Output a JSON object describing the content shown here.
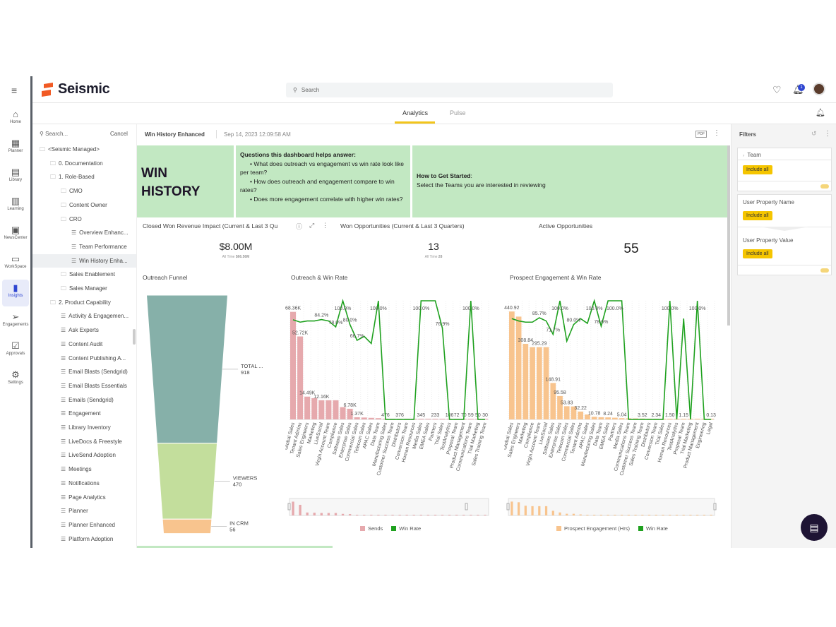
{
  "app": {
    "brand": "Seismic",
    "search_placeholder": "Search",
    "notification_count": "1"
  },
  "rail": [
    {
      "label": "Home",
      "icon": "⌂",
      "name": "home"
    },
    {
      "label": "Planner",
      "icon": "▦",
      "name": "planner"
    },
    {
      "label": "Library",
      "icon": "▤",
      "name": "library"
    },
    {
      "label": "Learning",
      "icon": "▥",
      "name": "learning"
    },
    {
      "label": "NewsCenter",
      "icon": "▣",
      "name": "newscenter"
    },
    {
      "label": "WorkSpace",
      "icon": "▭",
      "name": "workspace"
    },
    {
      "label": "Insights",
      "icon": "▮",
      "name": "insights",
      "active": true
    },
    {
      "label": "Engagements",
      "icon": "➢",
      "name": "engagements"
    },
    {
      "label": "Approvals",
      "icon": "☑",
      "name": "approvals"
    },
    {
      "label": "Settings",
      "icon": "⚙",
      "name": "settings"
    }
  ],
  "tabs": {
    "analytics": "Analytics",
    "pulse": "Pulse"
  },
  "tree": {
    "search_placeholder": "Search...",
    "cancel": "Cancel",
    "items": [
      {
        "label": "<Seismic Managed>",
        "level": 0,
        "type": "folder"
      },
      {
        "label": "0. Documentation",
        "level": 1,
        "type": "folder"
      },
      {
        "label": "1. Role-Based",
        "level": 1,
        "type": "folder"
      },
      {
        "label": "CMO",
        "level": 2,
        "type": "folder"
      },
      {
        "label": "Content Owner",
        "level": 2,
        "type": "folder"
      },
      {
        "label": "CRO",
        "level": 2,
        "type": "folder"
      },
      {
        "label": "Overview Enhanc...",
        "level": 3,
        "type": "report"
      },
      {
        "label": "Team Performance",
        "level": 3,
        "type": "report"
      },
      {
        "label": "Win History Enha...",
        "level": 3,
        "type": "report",
        "selected": true
      },
      {
        "label": "Sales Enablement",
        "level": 2,
        "type": "folder"
      },
      {
        "label": "Sales Manager",
        "level": 2,
        "type": "folder"
      },
      {
        "label": "2. Product Capability",
        "level": 1,
        "type": "folder"
      },
      {
        "label": "Activity & Engagemen...",
        "level": 2,
        "type": "report"
      },
      {
        "label": "Ask Experts",
        "level": 2,
        "type": "report"
      },
      {
        "label": "Content Audit",
        "level": 2,
        "type": "report"
      },
      {
        "label": "Content Publishing A...",
        "level": 2,
        "type": "report"
      },
      {
        "label": "Email Blasts (Sendgrid)",
        "level": 2,
        "type": "report"
      },
      {
        "label": "Email Blasts Essentials",
        "level": 2,
        "type": "report"
      },
      {
        "label": "Emails (Sendgrid)",
        "level": 2,
        "type": "report"
      },
      {
        "label": "Engagement",
        "level": 2,
        "type": "report"
      },
      {
        "label": "Library Inventory",
        "level": 2,
        "type": "report"
      },
      {
        "label": "LiveDocs & Freestyle",
        "level": 2,
        "type": "report"
      },
      {
        "label": "LiveSend Adoption",
        "level": 2,
        "type": "report"
      },
      {
        "label": "Meetings",
        "level": 2,
        "type": "report"
      },
      {
        "label": "Notifications",
        "level": 2,
        "type": "report"
      },
      {
        "label": "Page Analytics",
        "level": 2,
        "type": "report"
      },
      {
        "label": "Planner",
        "level": 2,
        "type": "report"
      },
      {
        "label": "Planner Enhanced",
        "level": 2,
        "type": "report"
      },
      {
        "label": "Platform Adoption",
        "level": 2,
        "type": "report"
      }
    ]
  },
  "report": {
    "title": "Win History Enhanced",
    "timestamp": "Sep 14, 2023 12:09:58 AM",
    "pdf_label": "PDF"
  },
  "banner": {
    "title_line1": "WIN",
    "title_line2": "HISTORY",
    "questions_heading": "Questions this dashboard helps answer:",
    "questions": [
      "What does outreach vs engagement vs win rate look like per team?",
      "How does outreach and engagement compare to win rates?",
      "Does more engagement correlate with higher win rates?"
    ],
    "start_heading": "How to Get Started",
    "start_text": "Select the Teams you are interested in reviewing"
  },
  "kpis": [
    {
      "title": "Closed Won Revenue Impact (Current & Last 3 Qu",
      "value": "$8.00M",
      "sub_label": "All Time",
      "sub_value": "$66.56M"
    },
    {
      "title": "Won Opportunities (Current & Last 3 Quarters)",
      "value": "13",
      "sub_label": "All Time",
      "sub_value": "28"
    },
    {
      "title": "Active Opportunities",
      "value": "55"
    }
  ],
  "funnel": {
    "title": "Outreach Funnel",
    "stages": [
      {
        "label": "TOTAL ...",
        "value": 918,
        "color": "#86b0a9"
      },
      {
        "label": "VIEWERS",
        "value": 470,
        "color": "#c3de9c"
      },
      {
        "label": "IN CRM",
        "value": 56,
        "color": "#f8c48e"
      }
    ]
  },
  "filters": {
    "title": "Filters",
    "team_label": "Team",
    "include_all": "Include all",
    "user_property_name": "User Property Name",
    "user_property_value": "User Property Value"
  },
  "chart_data": [
    {
      "type": "bar",
      "title": "Outreach & Win Rate",
      "categories": [
        "Global Sales",
        "Tenant Admins",
        "Sales Engineers",
        "Marketing",
        "LiveSocial",
        "Virgin Account Team",
        "Compliance",
        "Software Sales",
        "Enterprise Sales",
        "Commercial Sales",
        "Telecom Sales",
        "APAC Sales",
        "Data Team",
        "Manufacturing Sales",
        "Customer Success Team",
        "Distributors",
        "Conversion Team",
        "Human Resources",
        "Media Sales",
        "EMEA Sales",
        "Partners",
        "Trial Sales",
        "TestAnalytics",
        "Proposal Team",
        "Product Management",
        "Communications Team",
        "Trial Marketing",
        "Sales Training Team"
      ],
      "series": [
        {
          "name": "Sends",
          "type": "bar",
          "color": "#e6a9ad",
          "values": [
            68360,
            52720,
            14490,
            13500,
            12160,
            12160,
            12160,
            7800,
            6780,
            1370,
            1200,
            1000,
            800,
            476,
            400,
            376,
            360,
            350,
            345,
            300,
            233,
            150,
            106,
            72,
            70,
            59,
            50,
            30
          ],
          "labels": [
            "68.36K",
            "52.72K",
            "14.49K",
            "",
            "12.16K",
            "",
            "",
            "",
            "6.78K",
            "1.37K",
            "",
            "",
            "",
            "476",
            "",
            "376",
            "",
            "",
            "345",
            "",
            "233",
            "",
            "106",
            "72",
            "70",
            "59",
            "50",
            "30"
          ]
        },
        {
          "name": "Win Rate",
          "type": "line",
          "color": "#1fa11f",
          "values": [
            84.0,
            82.0,
            83.0,
            83.0,
            84.2,
            83.0,
            78.0,
            100.0,
            80.0,
            66.7,
            70.0,
            64.0,
            100.0,
            0,
            0,
            0,
            0,
            0,
            100.0,
            100.0,
            100.0,
            76.9,
            0,
            0,
            0,
            100.0,
            0,
            0
          ],
          "labels": [
            "",
            "",
            "",
            "",
            "84.2%",
            "",
            "78.0%",
            "100.0%",
            "80.0%",
            "66.7%",
            "",
            "",
            "100.0%",
            "",
            "",
            "",
            "",
            "",
            "100.0%",
            "",
            "",
            "76.9%",
            "",
            "",
            "",
            "100.0%",
            "",
            ""
          ]
        }
      ],
      "ylim_left": [
        0,
        70000
      ],
      "ylim_right": [
        0,
        100
      ]
    },
    {
      "type": "bar",
      "title": "Prospect Engagement & Win Rate",
      "categories": [
        "Global Sales",
        "Sales Engineers",
        "Marketing",
        "Compliance",
        "Virgin Account Team",
        "LiveSocial",
        "Software Sales",
        "Enterprise Sales",
        "Telecom Sales",
        "Commercial Sales",
        "Tenant Admins",
        "APAC Sales",
        "Manufacturing Sales",
        "Data Team",
        "EMEA Sales",
        "Partners",
        "Media Sales",
        "Communications Team",
        "Customer Success Team",
        "Sales Training Team",
        "Distributors",
        "Conversion Team",
        "Trial Sales",
        "Human Resources",
        "TestAnalytics",
        "Proposal Team",
        "Trial Marketing",
        "Product Management",
        "Engineering",
        "Legal"
      ],
      "series": [
        {
          "name": "Prospect Engagement (Hrs)",
          "type": "bar",
          "color": "#f8c48e",
          "values": [
            440.92,
            420,
            308.84,
            295.29,
            295.29,
            295.29,
            148.91,
            95.58,
            53.83,
            53,
            32.22,
            20,
            10.78,
            9,
            8.24,
            7,
            5.04,
            4.5,
            4,
            3.52,
            3,
            2.34,
            2,
            1.5,
            1.3,
            1.15,
            1,
            0.8,
            0.5,
            0.13
          ],
          "labels": [
            "440.92",
            "",
            "308.84",
            "",
            "295.29",
            "",
            "148.91",
            "95.58",
            "53.83",
            "",
            "32.22",
            "",
            "10.78",
            "",
            "8.24",
            "",
            "5.04",
            "",
            "",
            "3.52",
            "",
            "2.34",
            "",
            "1.50",
            "",
            "1.15",
            "",
            "",
            "",
            "0.13"
          ]
        },
        {
          "name": "Win Rate",
          "type": "line",
          "color": "#1fa11f",
          "values": [
            85.0,
            83.0,
            82.0,
            82.0,
            85.7,
            83.0,
            71.7,
            100.0,
            66.0,
            80.0,
            85.0,
            81.0,
            100.0,
            78.6,
            100.0,
            100.0,
            100.0,
            0,
            0,
            0,
            0,
            0,
            0,
            100.0,
            0,
            85.0,
            0,
            100.0,
            0,
            0
          ],
          "labels": [
            "440.92",
            "",
            "",
            "",
            "85.7%",
            "",
            "71.7%",
            "100.0%",
            "",
            "80.0%",
            "",
            "",
            "100.0%",
            "78.6%",
            "",
            "100.0%",
            "",
            "",
            "",
            "",
            "",
            "",
            "",
            "100.0%",
            "",
            "",
            "",
            "100.0%",
            "",
            ""
          ]
        }
      ],
      "ylim_left": [
        0,
        450
      ],
      "ylim_right": [
        0,
        100
      ]
    },
    {
      "type": "funnel",
      "title": "Outreach Funnel",
      "categories": [
        "TOTAL ...",
        "VIEWERS",
        "IN CRM"
      ],
      "values": [
        918,
        470,
        56
      ]
    }
  ]
}
